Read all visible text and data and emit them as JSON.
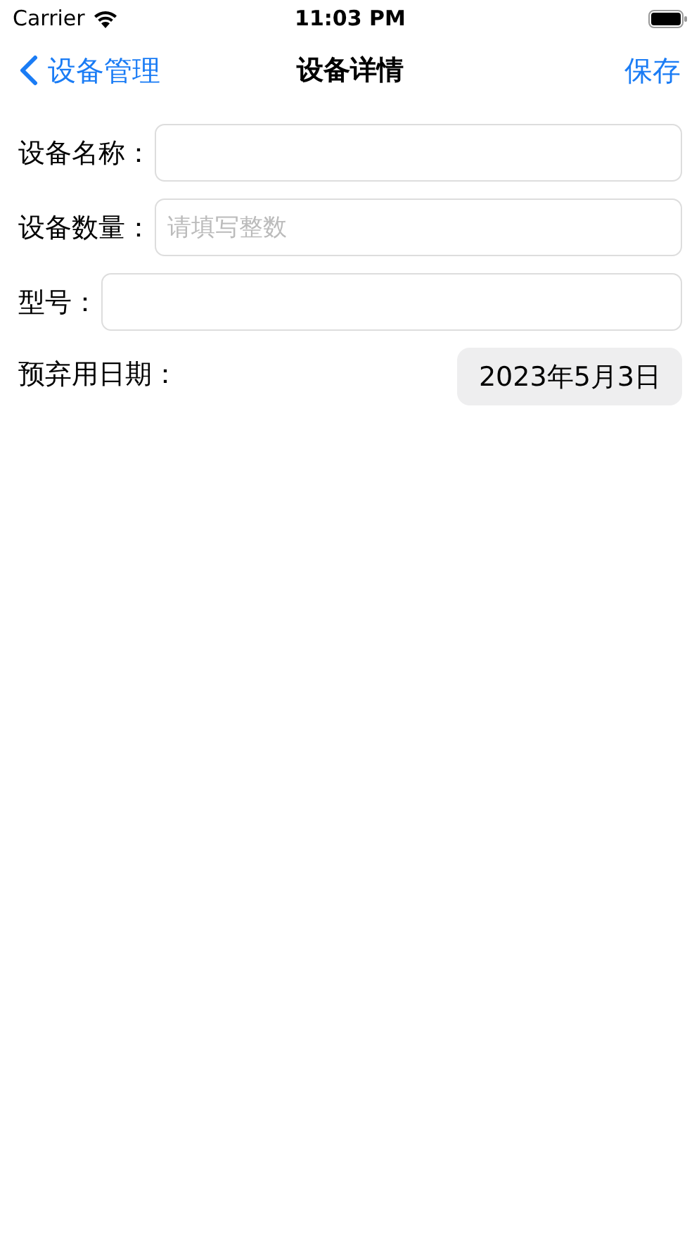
{
  "status_bar": {
    "carrier": "Carrier",
    "time": "11:03 PM"
  },
  "nav_bar": {
    "back": "设备管理",
    "title": "设备详情",
    "action": "保存"
  },
  "fields": [
    {
      "kind": "text",
      "label": "设备名称："
    },
    {
      "kind": "text",
      "label": "设备数量：",
      "placeholder": "请填写整数"
    },
    {
      "kind": "text",
      "label": "型号："
    },
    {
      "kind": "date",
      "label": "预弃用日期：",
      "value": "2023年5月3日"
    }
  ]
}
